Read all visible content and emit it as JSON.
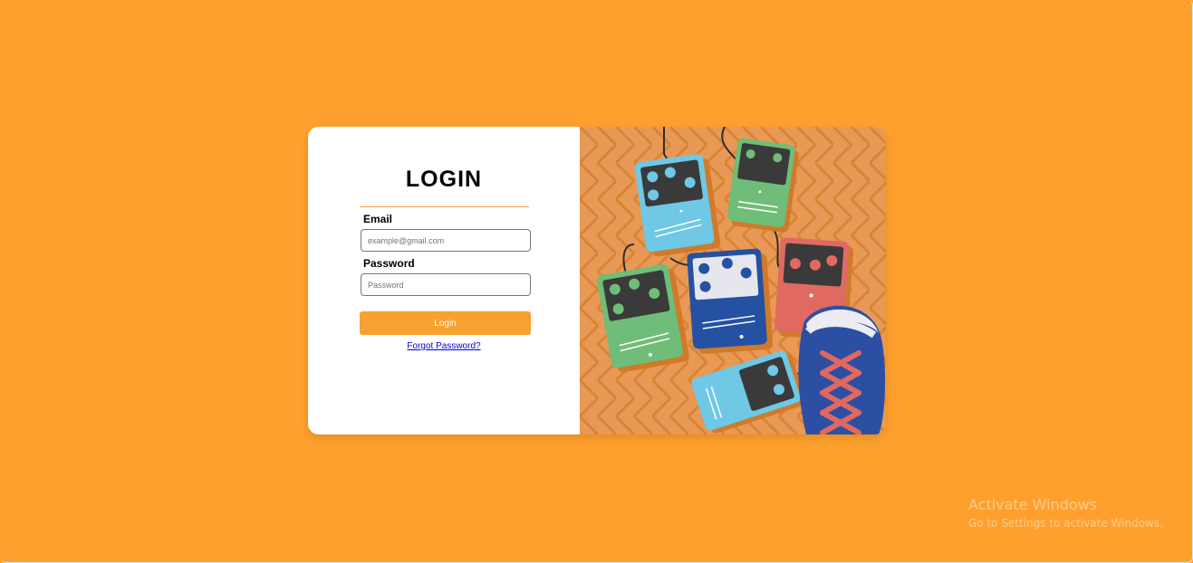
{
  "login": {
    "title": "LOGIN",
    "email_label": "Email",
    "email_placeholder": "example@gmail.com",
    "password_label": "Password",
    "password_placeholder": "Password",
    "login_button": "Login",
    "forgot_link": "Forgot Password?"
  },
  "watermark": {
    "line1": "Activate Windows",
    "line2": "Go to Settings to activate Windows."
  },
  "colors": {
    "page_background": "#ffa02e",
    "accent": "#f7a131",
    "illustration_background": "#e99956"
  },
  "illustration": {
    "subject": "guitar-effect-pedals-and-sneaker"
  }
}
